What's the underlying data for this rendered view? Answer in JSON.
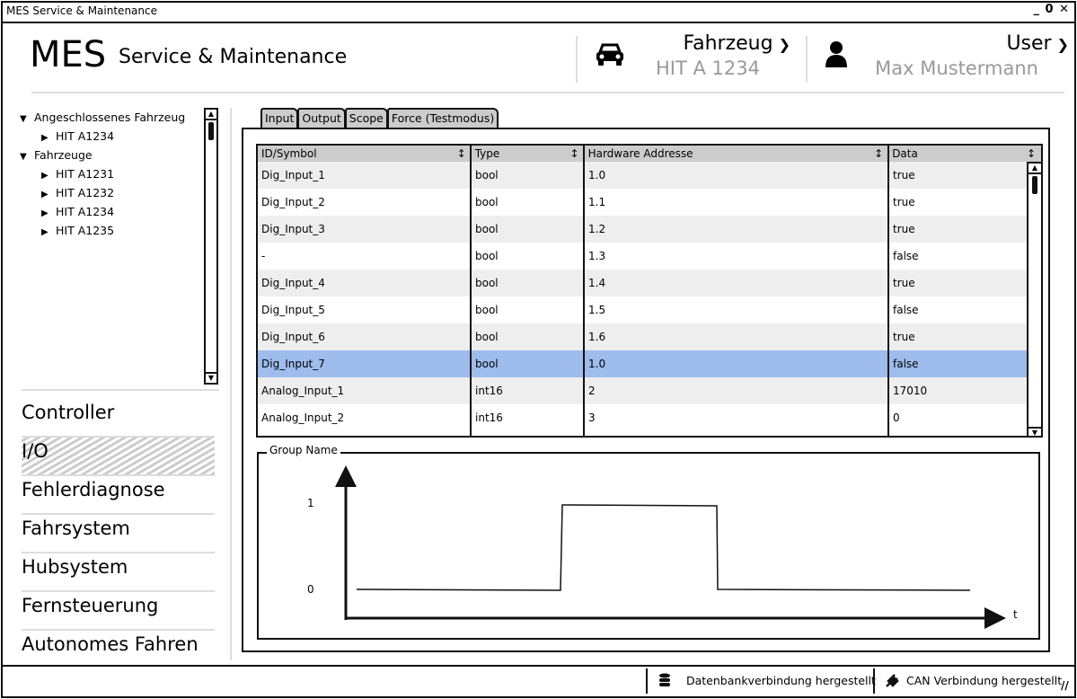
{
  "window": {
    "title": "MES Service & Maintenance",
    "controls": "_ 0 ✕"
  },
  "header": {
    "logo": "MES",
    "subtitle": "Service & Maintenance",
    "vehicle": {
      "label": "Fahrzeug",
      "value": "HIT A 1234",
      "icon": "car-icon"
    },
    "user": {
      "label": "User",
      "value": "Max Mustermann",
      "icon": "user-icon"
    }
  },
  "tree": [
    {
      "label": "Angeschlossenes Fahrzeug",
      "level": 0,
      "expanded": true
    },
    {
      "label": "HIT A1234",
      "level": 1,
      "expanded": false
    },
    {
      "label": "Fahrzeuge",
      "level": 0,
      "expanded": true
    },
    {
      "label": "HIT A1231",
      "level": 1,
      "expanded": false
    },
    {
      "label": "HIT A1232",
      "level": 1,
      "expanded": false
    },
    {
      "label": "HIT A1234",
      "level": 1,
      "expanded": false
    },
    {
      "label": "HIT A1235",
      "level": 1,
      "expanded": false
    }
  ],
  "nav": [
    {
      "label": "Controller",
      "selected": false
    },
    {
      "label": "I/O",
      "selected": true
    },
    {
      "label": "Fehlerdiagnose",
      "selected": false
    },
    {
      "label": "Fahrsystem",
      "selected": false
    },
    {
      "label": "Hubsystem",
      "selected": false
    },
    {
      "label": "Fernsteuerung",
      "selected": false
    },
    {
      "label": "Autonomes Fahren",
      "selected": false
    }
  ],
  "tabs": [
    "Input",
    "Output",
    "Scope",
    "Force (Testmodus)"
  ],
  "table": {
    "columns": [
      "ID/Symbol",
      "Type",
      "Hardware Addresse",
      "Data"
    ],
    "rows": [
      [
        "Dig_Input_1",
        "bool",
        "1.0",
        "true"
      ],
      [
        "Dig_Input_2",
        "bool",
        "1.1",
        "true"
      ],
      [
        "Dig_Input_3",
        "bool",
        "1.2",
        "true"
      ],
      [
        "-",
        "bool",
        "1.3",
        "false"
      ],
      [
        "Dig_Input_4",
        "bool",
        "1.4",
        "true"
      ],
      [
        "Dig_Input_5",
        "bool",
        "1.5",
        "false"
      ],
      [
        "Dig_Input_6",
        "bool",
        "1.6",
        "true"
      ],
      [
        "Dig_Input_7",
        "bool",
        "1.0",
        "false"
      ],
      [
        "Analog_Input_1",
        "int16",
        "2",
        "17010"
      ],
      [
        "Analog_Input_2",
        "int16",
        "3",
        "0"
      ]
    ],
    "selected_row": 7,
    "selection_color": "#9ebcec"
  },
  "group": {
    "title": "Group Name",
    "y_high": "1",
    "y_low": "0",
    "x_label": "t"
  },
  "status": {
    "db": "Datenbankverbindung hergestellt",
    "can": "CAN Verbindung hergestellt"
  }
}
